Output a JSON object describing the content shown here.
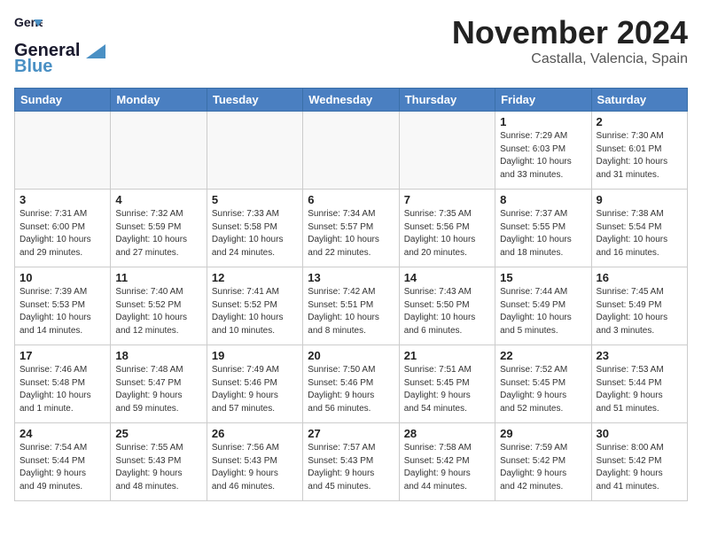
{
  "header": {
    "logo_general": "General",
    "logo_blue": "Blue",
    "month": "November 2024",
    "location": "Castalla, Valencia, Spain"
  },
  "days_of_week": [
    "Sunday",
    "Monday",
    "Tuesday",
    "Wednesday",
    "Thursday",
    "Friday",
    "Saturday"
  ],
  "weeks": [
    [
      {
        "day": "",
        "info": ""
      },
      {
        "day": "",
        "info": ""
      },
      {
        "day": "",
        "info": ""
      },
      {
        "day": "",
        "info": ""
      },
      {
        "day": "",
        "info": ""
      },
      {
        "day": "1",
        "info": "Sunrise: 7:29 AM\nSunset: 6:03 PM\nDaylight: 10 hours\nand 33 minutes."
      },
      {
        "day": "2",
        "info": "Sunrise: 7:30 AM\nSunset: 6:01 PM\nDaylight: 10 hours\nand 31 minutes."
      }
    ],
    [
      {
        "day": "3",
        "info": "Sunrise: 7:31 AM\nSunset: 6:00 PM\nDaylight: 10 hours\nand 29 minutes."
      },
      {
        "day": "4",
        "info": "Sunrise: 7:32 AM\nSunset: 5:59 PM\nDaylight: 10 hours\nand 27 minutes."
      },
      {
        "day": "5",
        "info": "Sunrise: 7:33 AM\nSunset: 5:58 PM\nDaylight: 10 hours\nand 24 minutes."
      },
      {
        "day": "6",
        "info": "Sunrise: 7:34 AM\nSunset: 5:57 PM\nDaylight: 10 hours\nand 22 minutes."
      },
      {
        "day": "7",
        "info": "Sunrise: 7:35 AM\nSunset: 5:56 PM\nDaylight: 10 hours\nand 20 minutes."
      },
      {
        "day": "8",
        "info": "Sunrise: 7:37 AM\nSunset: 5:55 PM\nDaylight: 10 hours\nand 18 minutes."
      },
      {
        "day": "9",
        "info": "Sunrise: 7:38 AM\nSunset: 5:54 PM\nDaylight: 10 hours\nand 16 minutes."
      }
    ],
    [
      {
        "day": "10",
        "info": "Sunrise: 7:39 AM\nSunset: 5:53 PM\nDaylight: 10 hours\nand 14 minutes."
      },
      {
        "day": "11",
        "info": "Sunrise: 7:40 AM\nSunset: 5:52 PM\nDaylight: 10 hours\nand 12 minutes."
      },
      {
        "day": "12",
        "info": "Sunrise: 7:41 AM\nSunset: 5:52 PM\nDaylight: 10 hours\nand 10 minutes."
      },
      {
        "day": "13",
        "info": "Sunrise: 7:42 AM\nSunset: 5:51 PM\nDaylight: 10 hours\nand 8 minutes."
      },
      {
        "day": "14",
        "info": "Sunrise: 7:43 AM\nSunset: 5:50 PM\nDaylight: 10 hours\nand 6 minutes."
      },
      {
        "day": "15",
        "info": "Sunrise: 7:44 AM\nSunset: 5:49 PM\nDaylight: 10 hours\nand 5 minutes."
      },
      {
        "day": "16",
        "info": "Sunrise: 7:45 AM\nSunset: 5:49 PM\nDaylight: 10 hours\nand 3 minutes."
      }
    ],
    [
      {
        "day": "17",
        "info": "Sunrise: 7:46 AM\nSunset: 5:48 PM\nDaylight: 10 hours\nand 1 minute."
      },
      {
        "day": "18",
        "info": "Sunrise: 7:48 AM\nSunset: 5:47 PM\nDaylight: 9 hours\nand 59 minutes."
      },
      {
        "day": "19",
        "info": "Sunrise: 7:49 AM\nSunset: 5:46 PM\nDaylight: 9 hours\nand 57 minutes."
      },
      {
        "day": "20",
        "info": "Sunrise: 7:50 AM\nSunset: 5:46 PM\nDaylight: 9 hours\nand 56 minutes."
      },
      {
        "day": "21",
        "info": "Sunrise: 7:51 AM\nSunset: 5:45 PM\nDaylight: 9 hours\nand 54 minutes."
      },
      {
        "day": "22",
        "info": "Sunrise: 7:52 AM\nSunset: 5:45 PM\nDaylight: 9 hours\nand 52 minutes."
      },
      {
        "day": "23",
        "info": "Sunrise: 7:53 AM\nSunset: 5:44 PM\nDaylight: 9 hours\nand 51 minutes."
      }
    ],
    [
      {
        "day": "24",
        "info": "Sunrise: 7:54 AM\nSunset: 5:44 PM\nDaylight: 9 hours\nand 49 minutes."
      },
      {
        "day": "25",
        "info": "Sunrise: 7:55 AM\nSunset: 5:43 PM\nDaylight: 9 hours\nand 48 minutes."
      },
      {
        "day": "26",
        "info": "Sunrise: 7:56 AM\nSunset: 5:43 PM\nDaylight: 9 hours\nand 46 minutes."
      },
      {
        "day": "27",
        "info": "Sunrise: 7:57 AM\nSunset: 5:43 PM\nDaylight: 9 hours\nand 45 minutes."
      },
      {
        "day": "28",
        "info": "Sunrise: 7:58 AM\nSunset: 5:42 PM\nDaylight: 9 hours\nand 44 minutes."
      },
      {
        "day": "29",
        "info": "Sunrise: 7:59 AM\nSunset: 5:42 PM\nDaylight: 9 hours\nand 42 minutes."
      },
      {
        "day": "30",
        "info": "Sunrise: 8:00 AM\nSunset: 5:42 PM\nDaylight: 9 hours\nand 41 minutes."
      }
    ]
  ]
}
